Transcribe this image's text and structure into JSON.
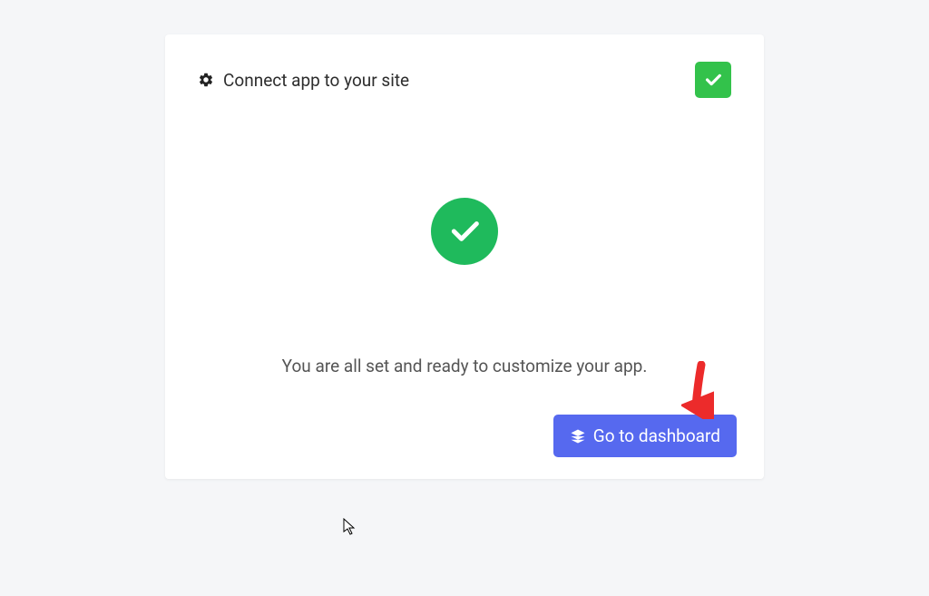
{
  "header": {
    "title": "Connect app to your site"
  },
  "content": {
    "message": "You are all set and ready to customize your app."
  },
  "actions": {
    "dashboard_label": "Go to dashboard"
  },
  "colors": {
    "success": "#1fba5c",
    "badge_success": "#33c24b",
    "primary": "#5669ef",
    "annotation": "#ec2b2b"
  }
}
